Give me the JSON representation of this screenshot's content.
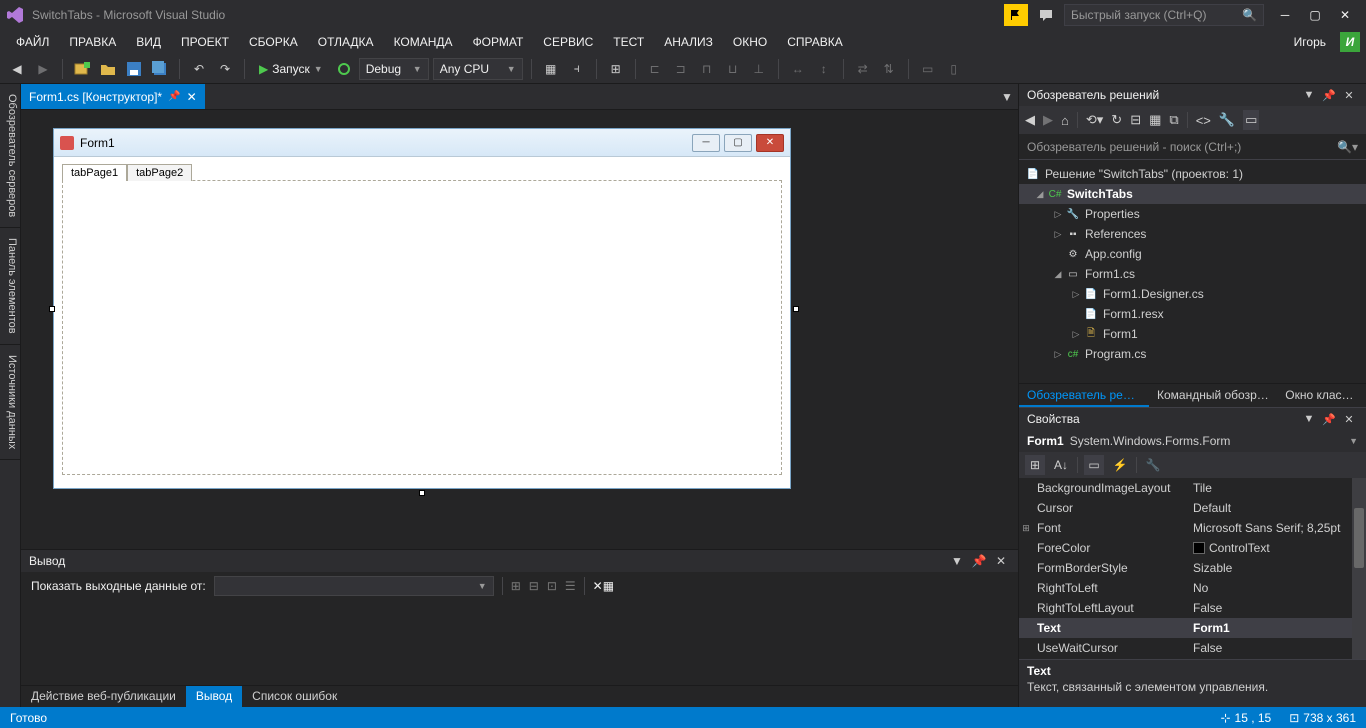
{
  "titlebar": {
    "title": "SwitchTabs - Microsoft Visual Studio",
    "quicklaunch_placeholder": "Быстрый запуск (Ctrl+Q)"
  },
  "menubar": {
    "items": [
      "ФАЙЛ",
      "ПРАВКА",
      "ВИД",
      "ПРОЕКТ",
      "СБОРКА",
      "ОТЛАДКА",
      "КОМАНДА",
      "ФОРМАТ",
      "СЕРВИС",
      "ТЕСТ",
      "АНАЛИЗ",
      "ОКНО",
      "СПРАВКА"
    ],
    "user": "Игорь",
    "user_initial": "И"
  },
  "toolbar": {
    "start_label": "Запуск",
    "config": "Debug",
    "platform": "Any CPU"
  },
  "tabs": {
    "file": "Form1.cs [Конструктор]*"
  },
  "leftrail": {
    "server_explorer": "Обозреватель серверов",
    "toolbox": "Панель элементов",
    "data_sources": "Источники данных"
  },
  "designer": {
    "form_title": "Form1",
    "tab1": "tabPage1",
    "tab2": "tabPage2"
  },
  "output": {
    "title": "Вывод",
    "filter_label": "Показать выходные данные от:",
    "bottom_tabs": {
      "webpub": "Действие веб-публикации",
      "output": "Вывод",
      "errors": "Список ошибок"
    }
  },
  "solution_explorer": {
    "title": "Обозреватель решений",
    "search_placeholder": "Обозреватель решений - поиск (Ctrl+;)",
    "solution_label": "Решение \"SwitchTabs\" (проектов: 1)",
    "project": "SwitchTabs",
    "properties": "Properties",
    "references": "References",
    "appconfig": "App.config",
    "form1cs": "Form1.cs",
    "form1designer": "Form1.Designer.cs",
    "form1resx": "Form1.resx",
    "form1class": "Form1",
    "programcs": "Program.cs",
    "tabs": {
      "sol": "Обозреватель реше...",
      "team": "Командный обозре...",
      "class": "Окно классов"
    }
  },
  "properties": {
    "title": "Свойства",
    "selector_name": "Form1",
    "selector_type": "System.Windows.Forms.Form",
    "rows": [
      {
        "name": "BackgroundImageLayout",
        "value": "Tile",
        "expand": ""
      },
      {
        "name": "Cursor",
        "value": "Default",
        "expand": ""
      },
      {
        "name": "Font",
        "value": "Microsoft Sans Serif; 8,25pt",
        "expand": "⊞"
      },
      {
        "name": "ForeColor",
        "value": "ControlText",
        "expand": "",
        "color": "#000"
      },
      {
        "name": "FormBorderStyle",
        "value": "Sizable",
        "expand": ""
      },
      {
        "name": "RightToLeft",
        "value": "No",
        "expand": ""
      },
      {
        "name": "RightToLeftLayout",
        "value": "False",
        "expand": ""
      },
      {
        "name": "Text",
        "value": "Form1",
        "expand": "",
        "selected": true
      },
      {
        "name": "UseWaitCursor",
        "value": "False",
        "expand": ""
      }
    ],
    "desc_name": "Text",
    "desc_text": "Текст, связанный с элементом управления."
  },
  "statusbar": {
    "ready": "Готово",
    "pos": "15 , 15",
    "size": "738 x 361"
  }
}
